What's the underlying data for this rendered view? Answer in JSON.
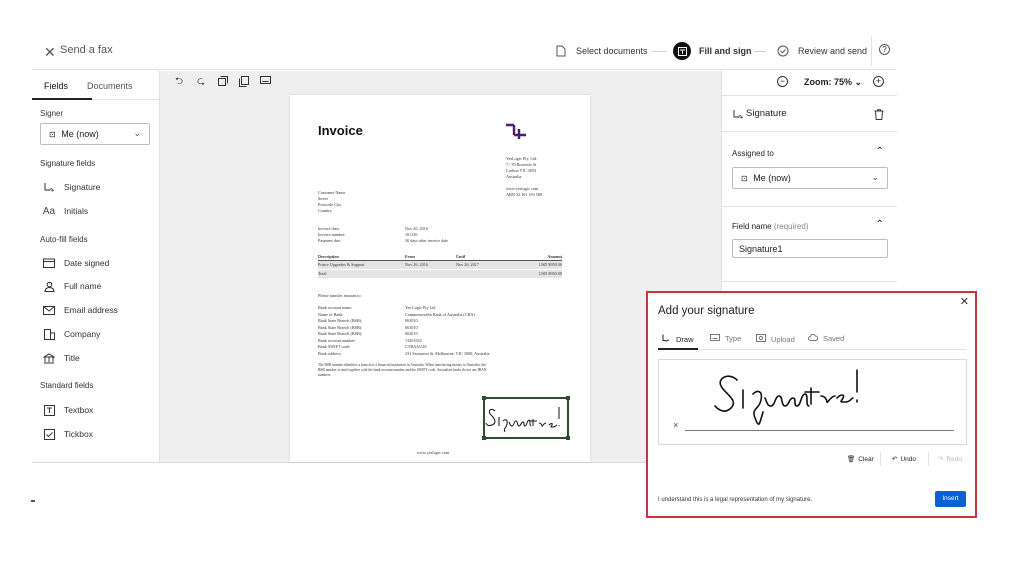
{
  "header": {
    "title": "Send a fax",
    "steps": [
      {
        "label": "Select documents"
      },
      {
        "label": "Fill and sign"
      },
      {
        "label": "Review and send"
      }
    ]
  },
  "left_panel": {
    "tabs": [
      {
        "label": "Fields"
      },
      {
        "label": "Documents"
      }
    ],
    "signer_label": "Signer",
    "signer_value": "Me (now)",
    "sections": {
      "signature": {
        "title": "Signature fields",
        "items": [
          {
            "label": "Signature"
          },
          {
            "label": "Initials"
          }
        ]
      },
      "autofill": {
        "title": "Auto-fill fields",
        "items": [
          {
            "label": "Date signed"
          },
          {
            "label": "Full name"
          },
          {
            "label": "Email address"
          },
          {
            "label": "Company"
          },
          {
            "label": "Title"
          }
        ]
      },
      "standard": {
        "title": "Standard fields",
        "items": [
          {
            "label": "Textbox"
          },
          {
            "label": "Tickbox"
          }
        ]
      }
    }
  },
  "zoom": {
    "label": "Zoom: 75%"
  },
  "right_panel": {
    "field_title": "Signature",
    "assigned_to_label": "Assigned to",
    "assigned_to_value": "Me (now)",
    "field_name_label": "Field name",
    "field_name_required": "(required)",
    "field_name_value": "Signature1"
  },
  "invoice": {
    "title": "Invoice",
    "company": [
      "YesLogic Pty. Ltd.",
      "7 / 39 Bouverie St",
      "Carlton VIC 3053",
      "Australia"
    ],
    "company_web": [
      "www.yeslogic.com",
      "ABN 32 101 193 560"
    ],
    "customer": [
      "Customer Name",
      "Street",
      "Postcode City",
      "Country"
    ],
    "meta": [
      {
        "label": "Invoice date:",
        "value": "Nov 26, 2016"
      },
      {
        "label": "Invoice number:",
        "value": "161126"
      },
      {
        "label": "Payment due:",
        "value": "30 days after invoice date"
      }
    ],
    "table": {
      "headers": [
        "Description",
        "From",
        "Until",
        "Amount"
      ],
      "row": [
        "Prince Upgrades & Support",
        "Nov 26, 2016",
        "Nov 26, 2017",
        "USD $950.00"
      ],
      "total_label": "Total",
      "total_value": "USD $950.00"
    },
    "transfer_heading": "Please transfer amount to:",
    "bank": [
      {
        "label": "Bank account name:",
        "value": "Yes Logic Pty Ltd"
      },
      {
        "label": "Name of Bank:",
        "value": "Commonwealth Bank of Australia (CBA)"
      },
      {
        "label": "Bank State Branch (BSB):",
        "value": "063010"
      },
      {
        "label": "Bank State Branch (BSB):",
        "value": "063010"
      },
      {
        "label": "Bank State Branch (BSB):",
        "value": "063019"
      },
      {
        "label": "Bank account number:",
        "value": "13201652"
      },
      {
        "label": "Bank SWIFT code:",
        "value": "CTBAAU2S"
      },
      {
        "label": "Bank address:",
        "value": "231 Swanston St, Melbourne, VIC 3000, Australia"
      }
    ],
    "note_lines": [
      "The BSB number identifies a branch of a financial institution in Australia. When transferring money to Australia, the",
      "BSB number is used together with the bank account number and the SWIFT code. Australian banks do not use IBAN",
      "numbers."
    ],
    "footer": "www.yeslogic.com"
  },
  "modal": {
    "title": "Add your signature",
    "tabs": [
      {
        "label": "Draw"
      },
      {
        "label": "Type"
      },
      {
        "label": "Upload"
      },
      {
        "label": "Saved"
      }
    ],
    "actions": {
      "clear": "Clear",
      "undo": "Undo",
      "redo": "Redo"
    },
    "legal": "I understand this is a legal representation of my signature.",
    "insert": "Insert"
  },
  "colors": {
    "accent_blue": "#0a61d6",
    "highlight_red": "#c9363a",
    "signature_field_border": "#2d4b2d",
    "brand_purple": "#4b1f6f"
  }
}
